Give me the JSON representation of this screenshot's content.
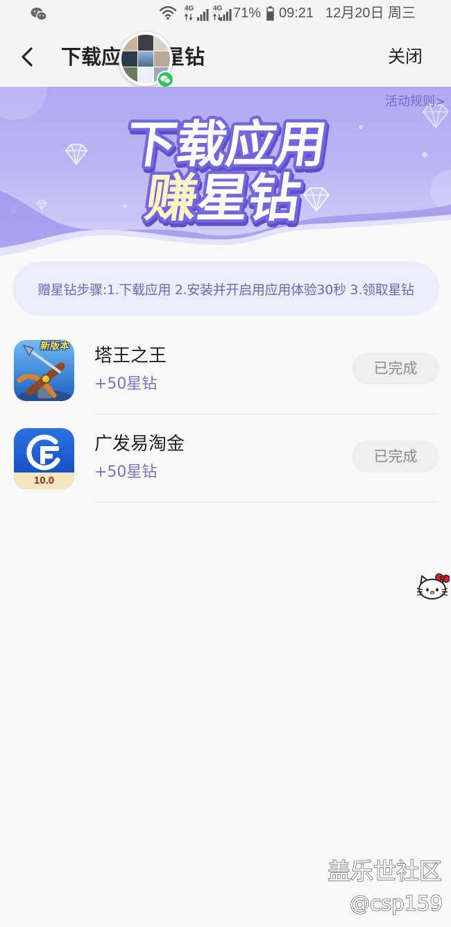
{
  "status_bar": {
    "notification_icon": "wechat-icon",
    "wifi_icon": "wifi-icon",
    "sim1_network": "4G",
    "sim2_network": "4G",
    "signal_icon": "signal-bars-icon",
    "battery_percent": "71%",
    "battery_icon": "battery-icon",
    "time": "09:21",
    "date": "12月20日 周三"
  },
  "header": {
    "back_icon": "back-arrow-icon",
    "title_visible_start": "下载应",
    "title_visible_end": "星钻",
    "close_label": "关闭"
  },
  "floating_chat_bubble": {
    "avatar_icon": "group-avatar-icon",
    "badge_icon": "wechat-icon"
  },
  "banner": {
    "rules_link": "活动规则>",
    "headline_line1": "下载应用",
    "headline_line2_first": "赚",
    "headline_line2_rest": "星钻",
    "decoration_icon": "diamond-icon"
  },
  "steps": {
    "text": "赠星钻步骤:1.下载应用 2.安装并开启用应用体验30秒 3.领取星钻"
  },
  "apps": [
    {
      "name": "塔王之王",
      "reward": "+50星钻",
      "status_button": "已完成",
      "icon": "tower-king-game-icon",
      "icon_label": "新版本"
    },
    {
      "name": "广发易淘金",
      "reward": "+50星钻",
      "status_button": "已完成",
      "icon": "gf-yitaojin-app-icon",
      "icon_label": "10.0"
    }
  ],
  "floating_sticker": {
    "icon": "hello-kitty-icon"
  },
  "watermark": {
    "line1": "盖乐世社区",
    "line2": "@csp159"
  },
  "colors": {
    "page_background": "#f8f8f8",
    "banner_purple": "#b0a9f1",
    "accent_text": "#7a70c4",
    "steps_background": "#ececfb",
    "button_background": "#eeeeee",
    "button_text": "#8a8a8a"
  }
}
